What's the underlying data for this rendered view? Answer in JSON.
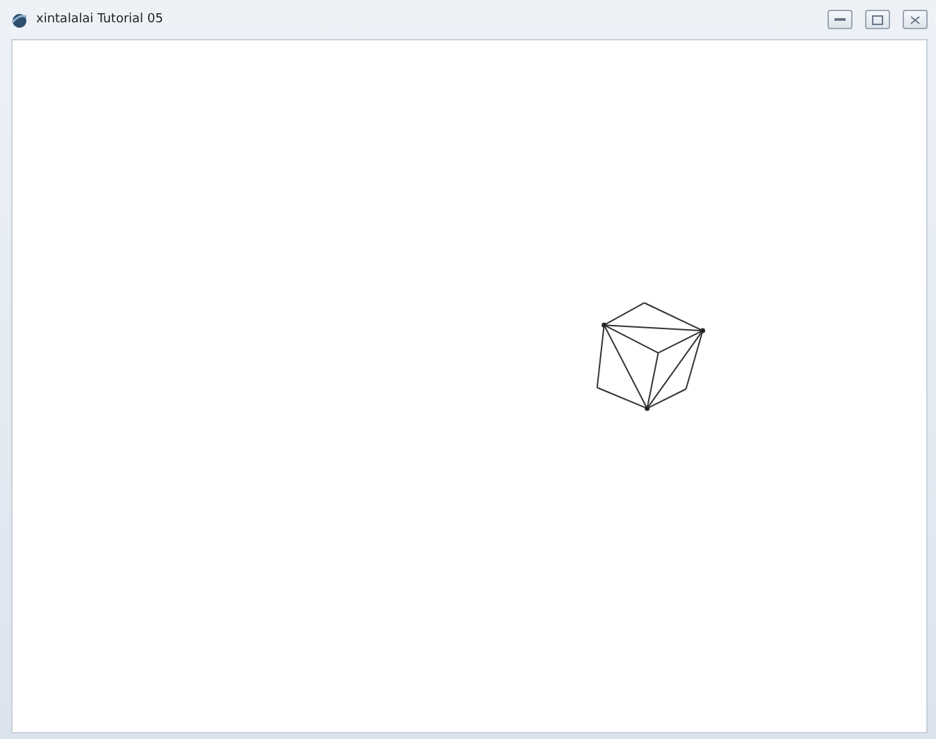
{
  "window": {
    "title": "xintalalai Tutorial 05"
  }
}
